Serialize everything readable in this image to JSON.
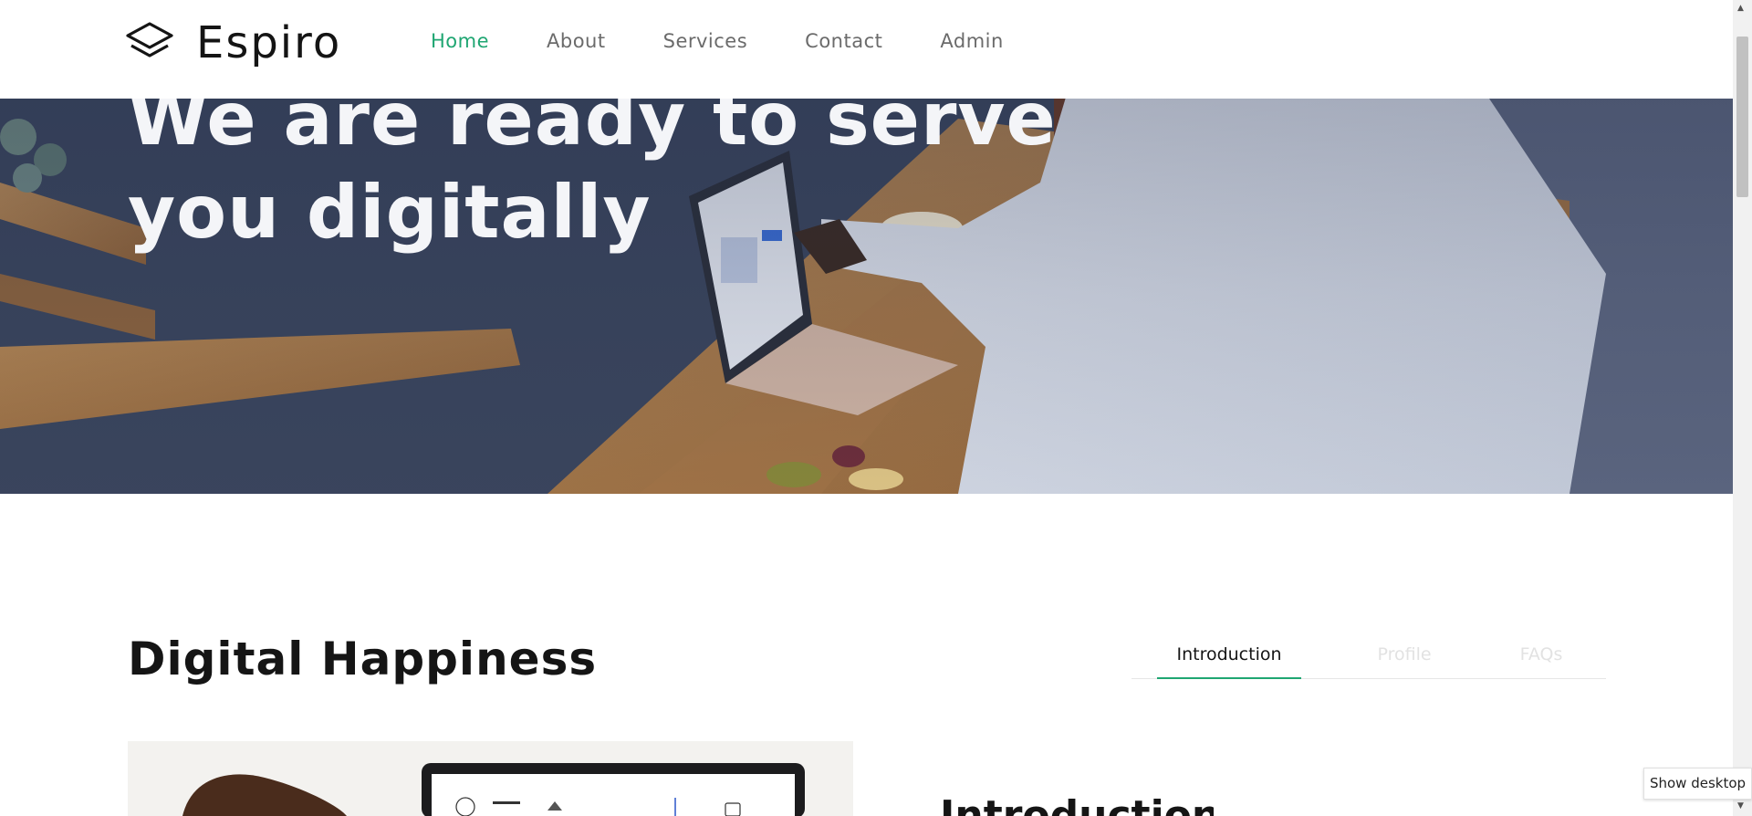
{
  "brand": {
    "name": "Espiro",
    "icon": "layers-icon"
  },
  "nav": {
    "items": [
      {
        "label": "Home",
        "active": true
      },
      {
        "label": "About",
        "active": false
      },
      {
        "label": "Services",
        "active": false
      },
      {
        "label": "Contact",
        "active": false
      },
      {
        "label": "Admin",
        "active": false
      }
    ]
  },
  "hero": {
    "title": "We are ready to serve you digitally"
  },
  "section": {
    "title": "Digital Happiness",
    "tabs": [
      {
        "label": "Introduction",
        "active": true
      },
      {
        "label": "Profile",
        "active": false
      },
      {
        "label": "FAQs",
        "active": false
      }
    ],
    "panel_heading": "Introduction"
  },
  "tooltip": {
    "text": "Show desktop"
  },
  "colors": {
    "accent": "#1fa672",
    "text": "#151515",
    "nav_text": "#6b6b6b"
  }
}
